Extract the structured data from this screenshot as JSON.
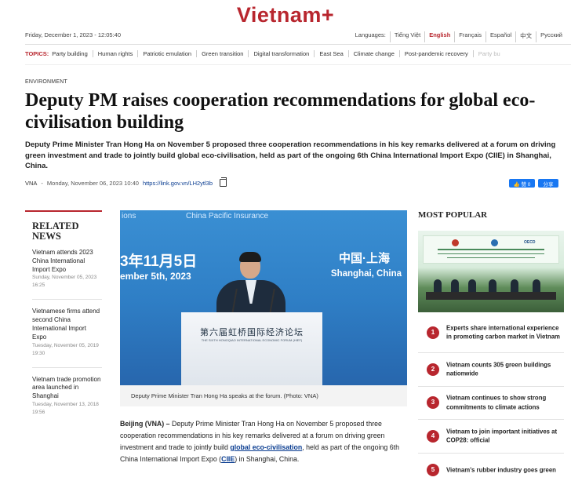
{
  "site": {
    "logo": "Vietnam+"
  },
  "topbar": {
    "datetime": "Friday, December 1, 2023 - 12:05:40",
    "languages_label": "Languages:",
    "languages": [
      "Tiếng Việt",
      "English",
      "Français",
      "Español",
      "中文",
      "Русский"
    ],
    "active_language": "English"
  },
  "topics": {
    "label": "TOPICS:",
    "items": [
      "Party building",
      "Human rights",
      "Patriotic emulation",
      "Green transition",
      "Digital transformation",
      "East Sea",
      "Climate change",
      "Post-pandemic recovery",
      "Party bu"
    ]
  },
  "article": {
    "section": "ENVIRONMENT",
    "headline": "Deputy PM raises cooperation recommendations for global eco-civilisation building",
    "lede": "Deputy Prime Minister Tran Hong Ha on November 5 proposed three cooperation recommendations in his key remarks delivered at a forum on driving green investment and trade to jointly build global eco-civilisation, held as part of the ongoing 6th China International Import Expo (CIIE) in Shanghai, China.",
    "source": "VNA",
    "separator": "-",
    "date": "Monday, November 06, 2023 10:40",
    "short_link": "https://link.gov.vn/LH2ytl3b",
    "like_label": "👍 赞 0",
    "share_label": "分享",
    "photo": {
      "header_left": "ions",
      "header_center": "China Pacific Insurance",
      "date_cn": "3年11月5日",
      "date_en": "ember 5th, 2023",
      "city_cn": "中国·上海",
      "city_en": "Shanghai, China",
      "podium_cn": "第六届虹桥国际经济论坛",
      "podium_en": "THE SIXTH HONGQIAO INTERNATIONAL ECONOMIC FORUM (HIEF)"
    },
    "caption": "Deputy Prime Minister Tran Hong Ha speaks at the forum. (Photo: VNA)",
    "body": {
      "dateline": "Beijing (VNA) –",
      "text1": " Deputy Prime Minister Tran Hong Ha on November 5 proposed three cooperation recommendations in his key remarks delivered at a forum on driving green investment and trade to jointly build ",
      "link1": "global eco-civilisation",
      "text2": ", held as part of the ongoing 6th China International Import Expo (",
      "link2": "CIIE",
      "text3": ") in Shanghai, China."
    }
  },
  "related": {
    "heading": "RELATED NEWS",
    "items": [
      {
        "title": "Vietnam attends 2023 China International Import Expo",
        "date": "Sunday, November 05, 2023 16:25"
      },
      {
        "title": "Vietnamese firms attend second China International Import Expo",
        "date": "Tuesday, November 05, 2019 19:30"
      },
      {
        "title": "Vietnam trade promotion area launched in Shanghai",
        "date": "Tuesday, November 13, 2018 19:56"
      }
    ]
  },
  "popular": {
    "heading": "MOST POPULAR",
    "image_text": "OECD",
    "items": [
      {
        "num": "1",
        "title": "Experts share international experience in promoting carbon market in Vietnam"
      },
      {
        "num": "2",
        "title": "Vietnam counts 305 green buildings nationwide"
      },
      {
        "num": "3",
        "title": "Vietnam continues to show strong commitments to climate actions"
      },
      {
        "num": "4",
        "title": "Vietnam to join important initiatives at COP28: official"
      },
      {
        "num": "5",
        "title": "Vietnam's rubber industry goes green"
      }
    ]
  },
  "colors": {
    "brand": "#b8262e",
    "link": "#0a3d91",
    "facebook": "#1877f2"
  }
}
